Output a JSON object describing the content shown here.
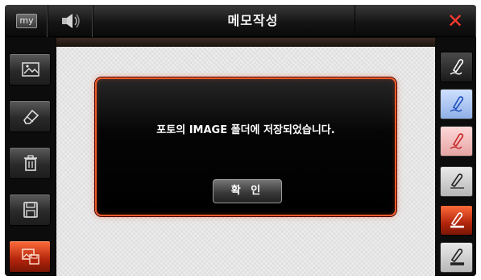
{
  "titlebar": {
    "my_label": "my",
    "title": "메모작성",
    "close_label": "✕",
    "icons": {
      "my": "my-icon",
      "sound": "speaker-icon",
      "close": "close-icon"
    }
  },
  "left_toolbar": {
    "buttons": [
      {
        "name": "image-icon",
        "active": false
      },
      {
        "name": "eraser-icon",
        "active": false
      },
      {
        "name": "trash-icon",
        "active": false
      },
      {
        "name": "save-icon",
        "active": false
      },
      {
        "name": "save-image-icon",
        "active": true
      }
    ]
  },
  "right_toolbar": {
    "pens": [
      {
        "name": "pen-white-icon",
        "style": "dark"
      },
      {
        "name": "pen-blue-icon",
        "style": "blue"
      },
      {
        "name": "pen-red-icon",
        "style": "red"
      },
      {
        "name": "pen-thin-icon",
        "style": "light"
      },
      {
        "name": "pen-medium-icon",
        "style": "active"
      },
      {
        "name": "pen-thick-icon",
        "style": "light"
      }
    ]
  },
  "dialog": {
    "message": "포토의 IMAGE 폴더에 저장되었습니다.",
    "confirm_label": "확 인"
  },
  "colors": {
    "accent": "#f05a2a",
    "close": "#ff3b2f"
  }
}
